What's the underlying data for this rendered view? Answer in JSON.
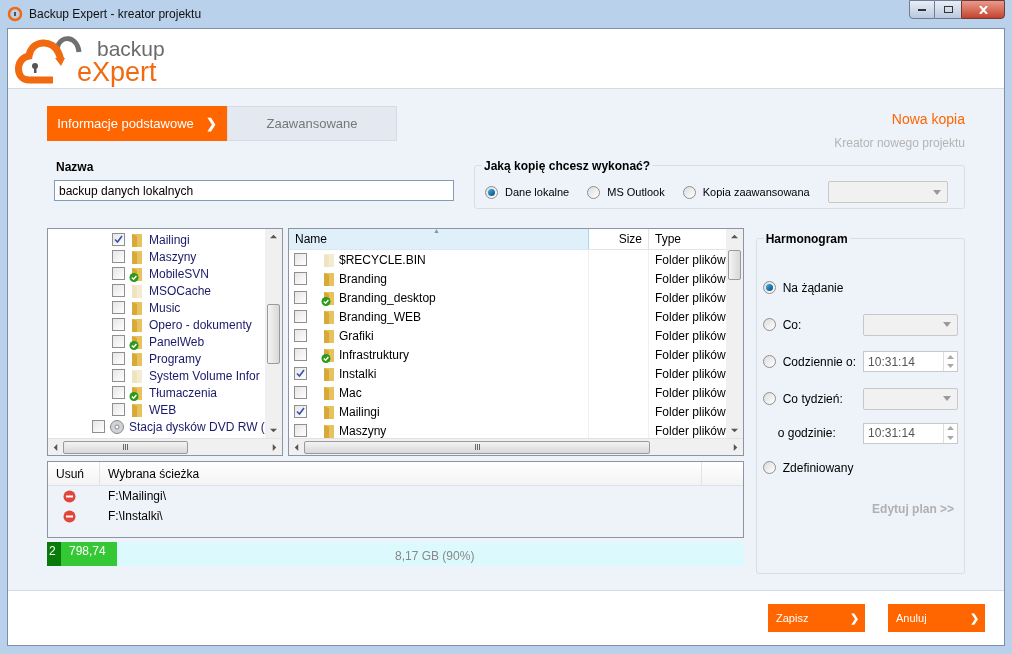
{
  "window": {
    "title": "Backup Expert - kreator projektu"
  },
  "logo": {
    "line1": "backup",
    "line2": "eXpert"
  },
  "tabs": [
    {
      "label": "Informacje podstawowe",
      "arrow": "❯",
      "selected": true
    },
    {
      "label": "Zaawansowane",
      "selected": false
    }
  ],
  "header": {
    "title": "Nowa kopia",
    "subtitle": "Kreator nowego projektu"
  },
  "name_group": {
    "legend": "Nazwa",
    "value": "backup danych lokalnych"
  },
  "type_group": {
    "legend": "Jaką kopię chcesz wykonać?",
    "options": [
      {
        "label": "Dane lokalne",
        "selected": true
      },
      {
        "label": "MS Outlook",
        "selected": false
      },
      {
        "label": "Kopia zaawansowana",
        "selected": false
      }
    ]
  },
  "tree": {
    "items": [
      {
        "label": "Mailingi",
        "kind": "folder",
        "checked": true,
        "synced": false
      },
      {
        "label": "Maszyny",
        "kind": "folder",
        "checked": false,
        "synced": false
      },
      {
        "label": "MobileSVN",
        "kind": "folder",
        "checked": false,
        "synced": true
      },
      {
        "label": "MSOCache",
        "kind": "hidden",
        "checked": false,
        "synced": false
      },
      {
        "label": "Music",
        "kind": "folder",
        "checked": false,
        "synced": false
      },
      {
        "label": "Opero - dokumenty",
        "kind": "folder",
        "checked": false,
        "synced": false
      },
      {
        "label": "PanelWeb",
        "kind": "folder",
        "checked": false,
        "synced": true
      },
      {
        "label": "Programy",
        "kind": "folder",
        "checked": false,
        "synced": false
      },
      {
        "label": "System Volume Infor",
        "kind": "hidden",
        "checked": false,
        "synced": false
      },
      {
        "label": "Tłumaczenia",
        "kind": "folder",
        "checked": false,
        "synced": true
      },
      {
        "label": "WEB",
        "kind": "folder",
        "checked": false,
        "synced": false
      },
      {
        "label": "Stacja dysków DVD RW (",
        "kind": "drive",
        "checked": false,
        "synced": false
      }
    ]
  },
  "files": {
    "columns": [
      "Name",
      "Size",
      "Type"
    ],
    "sort_arrow": "▲",
    "rows": [
      {
        "name": "$RECYCLE.BIN",
        "type": "Folder plików",
        "kind": "hidden",
        "checked": false,
        "synced": false
      },
      {
        "name": "Branding",
        "type": "Folder plików",
        "kind": "folder",
        "checked": false,
        "synced": false
      },
      {
        "name": "Branding_desktop",
        "type": "Folder plików",
        "kind": "folder",
        "checked": false,
        "synced": true
      },
      {
        "name": "Branding_WEB",
        "type": "Folder plików",
        "kind": "folder",
        "checked": false,
        "synced": false
      },
      {
        "name": "Grafiki",
        "type": "Folder plików",
        "kind": "folder",
        "checked": false,
        "synced": false
      },
      {
        "name": "Infrastruktury",
        "type": "Folder plików",
        "kind": "folder",
        "checked": false,
        "synced": true
      },
      {
        "name": "Instalki",
        "type": "Folder plików",
        "kind": "folder",
        "checked": true,
        "synced": false
      },
      {
        "name": "Mac",
        "type": "Folder plików",
        "kind": "folder",
        "checked": false,
        "synced": false
      },
      {
        "name": "Mailingi",
        "type": "Folder plików",
        "kind": "folder",
        "checked": true,
        "synced": false
      },
      {
        "name": "Maszyny",
        "type": "Folder plików",
        "kind": "folder",
        "checked": false,
        "synced": false
      }
    ]
  },
  "selected_paths": {
    "columns": [
      "Usuń",
      "Wybrana ścieżka"
    ],
    "rows": [
      {
        "path": "F:\\Mailingi\\"
      },
      {
        "path": "F:\\Instalki\\"
      }
    ]
  },
  "usage": {
    "count": "2",
    "size": "798,74",
    "free": "8,17 GB (90%)",
    "level": 0.1
  },
  "schedule": {
    "legend": "Harmonogram",
    "options": [
      {
        "label": "Na żądanie",
        "kind": "radio",
        "selected": true
      },
      {
        "label": "Co:",
        "kind": "radio",
        "selected": false,
        "field": {
          "kind": "dropdown"
        }
      },
      {
        "label": "Codziennie o:",
        "kind": "radio",
        "selected": false,
        "field": {
          "kind": "time",
          "value": "10:31:14"
        }
      },
      {
        "label": "Co tydzień:",
        "kind": "radio",
        "selected": false,
        "field": {
          "kind": "dropdown"
        }
      },
      {
        "label": "o godzinie:",
        "kind": "label",
        "field": {
          "kind": "time",
          "value": "10:31:14"
        }
      },
      {
        "label": "Zdefiniowany",
        "kind": "radio",
        "selected": false
      }
    ],
    "link": "Edytuj plan >>"
  },
  "buttons": [
    {
      "label": "Zapisz",
      "arrow": "❯"
    },
    {
      "label": "Anuluj",
      "arrow": "❯"
    }
  ]
}
